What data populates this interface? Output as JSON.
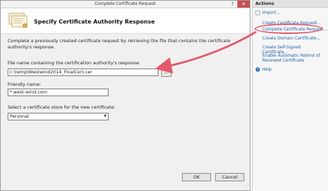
{
  "window": {
    "title": "Complete Certificate Request",
    "help_glyph": "?",
    "close_glyph": "✕"
  },
  "header": {
    "title": "Specify Certificate Authority Response"
  },
  "form": {
    "description": "Complete a previously created certificate request by retrieving the file that contains the certificate authority's response.",
    "file_label": "File name containing the certification authority's response:",
    "file_value": "c:\\temp\\Westwind2014_FinalCert.cer",
    "browse_label": "...",
    "friendly_label": "Friendly name:",
    "friendly_value": "*.west-wind.com",
    "store_label": "Select a certificate store for the new certificate:",
    "store_value": "Personal"
  },
  "footer": {
    "ok_label": "OK",
    "cancel_label": "Cancel"
  },
  "actions": {
    "title": "Actions",
    "items": [
      {
        "label": "Import..."
      },
      {
        "label": "Create Certificate Request..."
      },
      {
        "label": "Complete Certificate Request..."
      },
      {
        "label": "Create Domain Certificate..."
      },
      {
        "label": "Create Self-Signed Certificate..."
      },
      {
        "label": "Enable Automatic Rebind of Renewed Certificate"
      },
      {
        "label": "Help"
      }
    ]
  },
  "colors": {
    "highlight": "#e35a6a",
    "link": "#1f5fa8"
  }
}
